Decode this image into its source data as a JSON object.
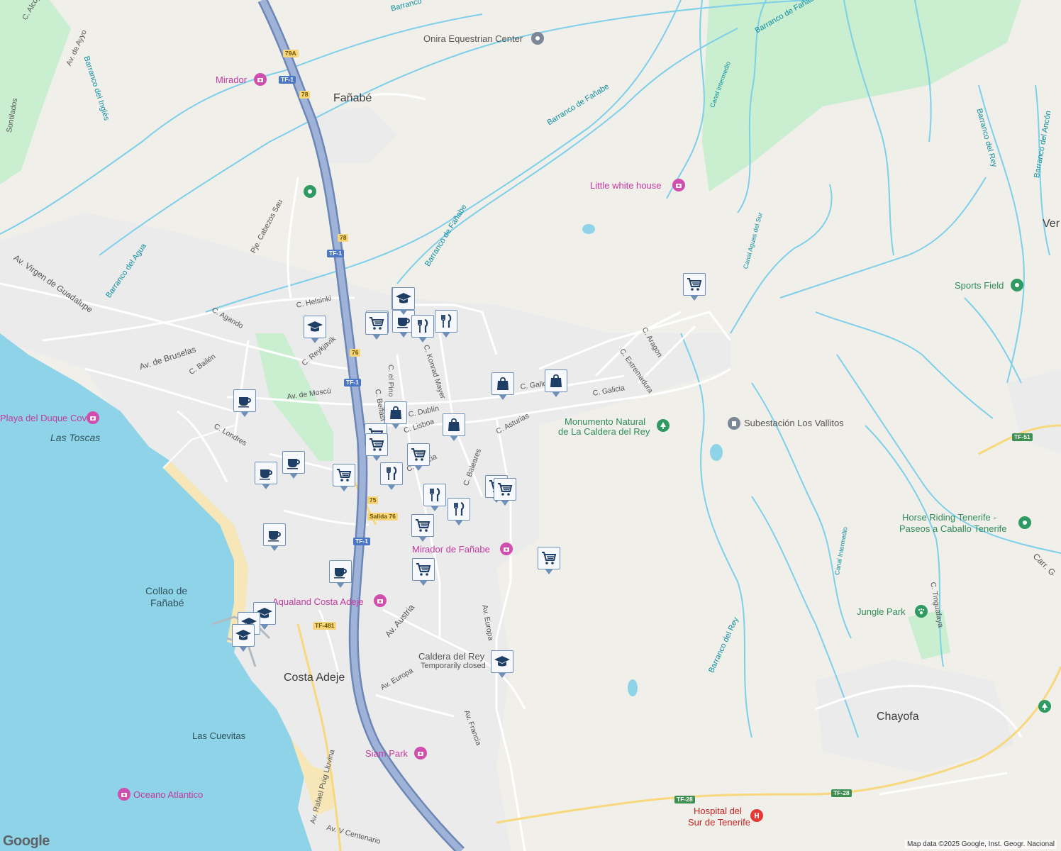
{
  "colors": {
    "land": "#f1efe9",
    "sea": "#8fd3e8",
    "park": "#bdebc8",
    "stream": "#7dcfea",
    "highway": "#8fa6cc",
    "marker_border": "#6e8fb8",
    "marker_icon": "#1f3e66"
  },
  "places": [
    {
      "name": "Fañabé"
    },
    {
      "name": "Las Toscas"
    },
    {
      "name": "Costa Adeje"
    },
    {
      "name": "Collao de"
    },
    {
      "name": "Fañabé"
    },
    {
      "name": "Las Cuevitas"
    },
    {
      "name": "Chayofa"
    },
    {
      "name": "Ver"
    }
  ],
  "streets": [
    "C. Alcojor",
    "Av. de Ayyo",
    "Barranco del Inglés",
    "Barranco de Fañabe",
    "Barranco de Fañabe",
    "Barranco de Fañabe",
    "Barranco del Agua",
    "Pje. Cabezos Sau",
    "Av. Virgen de Guadalupe",
    "C. Agando",
    "C. Helsinki",
    "C. Reykjavik",
    "Av. de Bruselas",
    "C. Bailén",
    "Av. de Moscú",
    "C. Londres",
    "C. el Pino",
    "C. Konrad Mayer",
    "C. Belfast",
    "C. Dublín",
    "C. Lisboa",
    "C. Galicia",
    "C. Galicia",
    "C. Galicia",
    "C. Asturias",
    "C. Baleares",
    "C. Aragon",
    "C. Extremadura",
    "Canal Intermedio",
    "Canal Aguas del Sur",
    "Barranco del Rey",
    "Barranco del Rey",
    "Barranco del Ancón",
    "Av. Europa",
    "Av. Austria",
    "Av. Europa",
    "Av. Francia",
    "Av. Rafael Puig Lluvina",
    "Av. V Centenario",
    "Canal Intermedio",
    "C. Tinguafaya",
    "Carr. G",
    "Sontilados",
    "Barranco"
  ],
  "pois": [
    {
      "name": "Onira Equestrian Center",
      "kind": "gray",
      "icon": "pin-icon"
    },
    {
      "name": "Mirador",
      "kind": "pink",
      "icon": "camera-icon"
    },
    {
      "name": "Little white house",
      "kind": "pink",
      "icon": "camera-icon"
    },
    {
      "name": "Sports Field",
      "kind": "green",
      "icon": "pin-icon"
    },
    {
      "name": "Playa del Duque Cove",
      "kind": "pink",
      "icon": "camera-icon"
    },
    {
      "name": "Monumento Natural",
      "kind": "green",
      "icon": "tree-icon"
    },
    {
      "name": "de La Caldera del Rey",
      "kind": "green",
      "icon": ""
    },
    {
      "name": "Subestación Los Vallitos",
      "kind": "gray",
      "icon": "building-icon"
    },
    {
      "name": "Horse Riding Tenerife -",
      "kind": "green",
      "icon": "pin-icon"
    },
    {
      "name": "Paseos a Caballo Tenerife",
      "kind": "green",
      "icon": ""
    },
    {
      "name": "Mirador de Fañabe",
      "kind": "pink",
      "icon": "camera-icon"
    },
    {
      "name": "Aqualand Costa Adeje",
      "kind": "pink",
      "icon": "camera-icon"
    },
    {
      "name": "Jungle Park",
      "kind": "green",
      "icon": "paw-icon"
    },
    {
      "name": "Caldera del Rey",
      "kind": "gray",
      "icon": ""
    },
    {
      "name": "Temporarily closed",
      "kind": "gray",
      "icon": ""
    },
    {
      "name": "Siam Park",
      "kind": "pink",
      "icon": "camera-icon"
    },
    {
      "name": "Oceano Atlantico",
      "kind": "pink",
      "icon": "camera-icon"
    },
    {
      "name": "Hospital del",
      "kind": "red",
      "icon": "hospital-icon"
    },
    {
      "name": "Sur de Tenerife",
      "kind": "red",
      "icon": ""
    }
  ],
  "road_numbers": [
    "79A",
    "TF-1",
    "78",
    "78",
    "TF-1",
    "76",
    "TF-1",
    "75",
    "Salida 76",
    "TF-1",
    "TF-481",
    "TF-28",
    "TF-28",
    "TF-51"
  ],
  "markers": [
    "graduation-cap-icon",
    "cart-icon",
    "graduation-cap-icon",
    "cart-icon",
    "coffee-cup-icon",
    "restaurant-icon",
    "restaurant-icon",
    "graduation-cap-icon",
    "shopping-bag-icon",
    "shopping-bag-icon",
    "coffee-cup-icon",
    "shopping-bag-icon",
    "cart-icon",
    "shopping-bag-icon",
    "cart-icon",
    "cart-icon",
    "coffee-cup-icon",
    "coffee-cup-icon",
    "cart-icon",
    "restaurant-icon",
    "cart-icon",
    "cart-icon",
    "restaurant-icon",
    "restaurant-icon",
    "cart-icon",
    "cart-icon",
    "coffee-cup-icon",
    "coffee-cup-icon",
    "cart-icon",
    "graduation-cap-icon",
    "graduation-cap-icon",
    "graduation-cap-icon",
    "cart-icon",
    "graduation-cap-icon"
  ],
  "attribution": "Map data ©2025 Google, Inst. Geogr. Nacional",
  "logo": "Google"
}
